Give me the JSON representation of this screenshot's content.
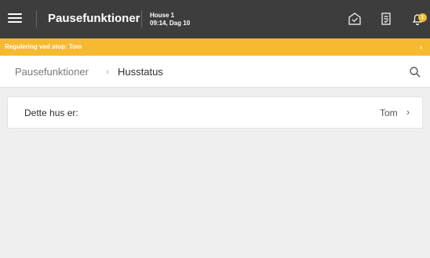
{
  "header": {
    "title": "Pausefunktioner",
    "house_name": "House 1",
    "house_time": "09:14, Dag 10",
    "notification_count": "1",
    "icons": [
      "menu-icon",
      "house-check-icon",
      "checklist-icon",
      "bell-icon"
    ]
  },
  "alert": {
    "text": "Regulering ved stop: Tom",
    "chevron": "›"
  },
  "breadcrumb": {
    "root": "Pausefunktioner",
    "separator": "›",
    "current": "Husstatus"
  },
  "card": {
    "label": "Dette hus er:",
    "value": "Tom",
    "chevron": "›"
  },
  "colors": {
    "topbar": "#3d3d3d",
    "accent": "#f6b930",
    "background": "#efefef"
  }
}
